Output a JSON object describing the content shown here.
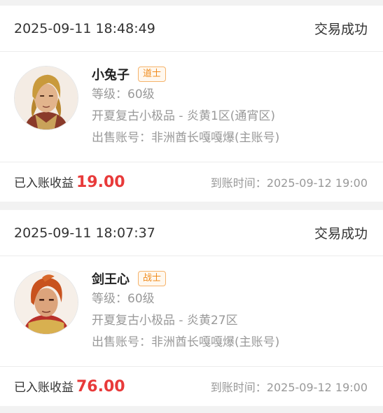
{
  "orders": [
    {
      "timestamp": "2025-09-11 18:48:49",
      "status": "交易成功",
      "character": {
        "name": "小兔子",
        "class": "道士",
        "level_label": "等级：",
        "level": "60级",
        "server": "开夏复古小极品 - 炎黄1区(通宵区)",
        "seller_label": "出售账号：",
        "seller": "非洲酋长嘎嘎爆(主账号)",
        "avatar_icon": "taoist-hero-portrait"
      },
      "income_label": "已入账收益",
      "income": "19.00",
      "arrival_label": "到账时间：",
      "arrival_time": "2025-09-12 19:00"
    },
    {
      "timestamp": "2025-09-11 18:07:37",
      "status": "交易成功",
      "character": {
        "name": "剑王心",
        "class": "战士",
        "level_label": "等级：",
        "level": "60级",
        "server": "开夏复古小极品 - 炎黄27区",
        "seller_label": "出售账号：",
        "seller": "非洲酋长嘎嘎爆(主账号)",
        "avatar_icon": "warrior-hero-portrait"
      },
      "income_label": "已入账收益",
      "income": "76.00",
      "arrival_label": "到账时间：",
      "arrival_time": "2025-09-12 19:00"
    }
  ],
  "colors": {
    "accent_red": "#e83a3a",
    "badge_orange": "#f08c1e",
    "page_bg": "#f2f2f2"
  }
}
